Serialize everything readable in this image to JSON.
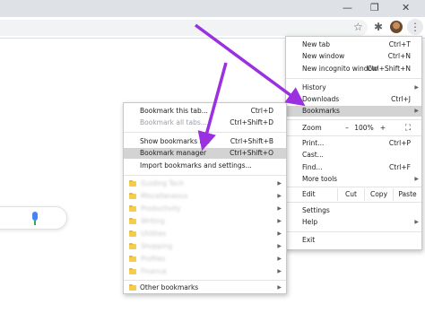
{
  "chrome": {
    "minimize": "—",
    "restore": "❐",
    "close": "✕",
    "star": "☆",
    "extensions": "✱",
    "more": "⋮"
  },
  "chrome_menu": {
    "new_tab": {
      "label": "New tab",
      "shortcut": "Ctrl+T"
    },
    "new_window": {
      "label": "New window",
      "shortcut": "Ctrl+N"
    },
    "incognito": {
      "label": "New incognito window",
      "shortcut": "Ctrl+Shift+N"
    },
    "history": {
      "label": "History"
    },
    "downloads": {
      "label": "Downloads",
      "shortcut": "Ctrl+J"
    },
    "bookmarks": {
      "label": "Bookmarks"
    },
    "zoom": {
      "label": "Zoom",
      "minus": "–",
      "value": "100%",
      "plus": "+",
      "fullscreen": "⛶"
    },
    "print": {
      "label": "Print...",
      "shortcut": "Ctrl+P"
    },
    "cast": {
      "label": "Cast..."
    },
    "find": {
      "label": "Find...",
      "shortcut": "Ctrl+F"
    },
    "more_tools": {
      "label": "More tools"
    },
    "edit": {
      "label": "Edit",
      "cut": "Cut",
      "copy": "Copy",
      "paste": "Paste"
    },
    "settings": {
      "label": "Settings"
    },
    "help": {
      "label": "Help"
    },
    "exit": {
      "label": "Exit"
    }
  },
  "bookmarks_menu": {
    "bookmark_tab": {
      "label": "Bookmark this tab...",
      "shortcut": "Ctrl+D"
    },
    "bookmark_all": {
      "label": "Bookmark all tabs...",
      "shortcut": "Ctrl+Shift+D"
    },
    "show_bar": {
      "label": "Show bookmarks bar",
      "shortcut": "Ctrl+Shift+B"
    },
    "manager": {
      "label": "Bookmark manager",
      "shortcut": "Ctrl+Shift+O"
    },
    "import": {
      "label": "Import bookmarks and settings..."
    },
    "folders": [
      "Guiding Tech",
      "Miscellaneous",
      "Productivity",
      "Writing",
      "Utilities",
      "Shopping",
      "Profiles",
      "Finance"
    ],
    "other": {
      "label": "Other bookmarks"
    }
  },
  "colors": {
    "arrow": "#9b30e0",
    "highlight": "#d3d3d3",
    "folder": "#f6cc4c"
  }
}
